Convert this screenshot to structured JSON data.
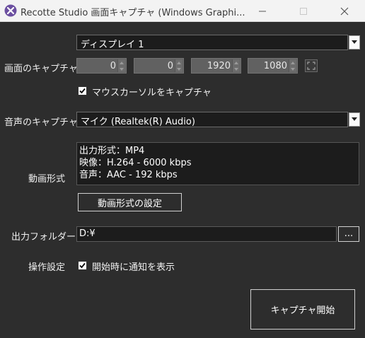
{
  "window": {
    "title": "Recotte Studio 画面キャプチャ (Windows Graphi...",
    "icon": "recotte-logo-icon"
  },
  "display": {
    "selected": "ディスプレイ 1"
  },
  "capture": {
    "label": "画面のキャプチャ",
    "x": "0",
    "y": "0",
    "width": "1920",
    "height": "1080",
    "mouse_cursor_label": "マウスカーソルをキャプチャ",
    "mouse_cursor_checked": true
  },
  "audio": {
    "label": "音声のキャプチャ",
    "selected": "マイク (Realtek(R) Audio)"
  },
  "video_format": {
    "label": "動画形式",
    "info_line1": "出力形式：MP4",
    "info_line2": "映像：H.264 - 6000 kbps",
    "info_line3": "音声：AAC - 192 kbps",
    "settings_button": "動画形式の設定"
  },
  "output": {
    "label": "出力フォルダー",
    "path": "D:¥",
    "browse_button": "..."
  },
  "operation": {
    "label": "操作設定",
    "notify_label": "開始時に通知を表示",
    "notify_checked": true
  },
  "start_button": "キャプチャ開始",
  "colors": {
    "background": "#2d2d2d",
    "field": "#1c1c1c",
    "logo_purple": "#6b4fa0"
  }
}
